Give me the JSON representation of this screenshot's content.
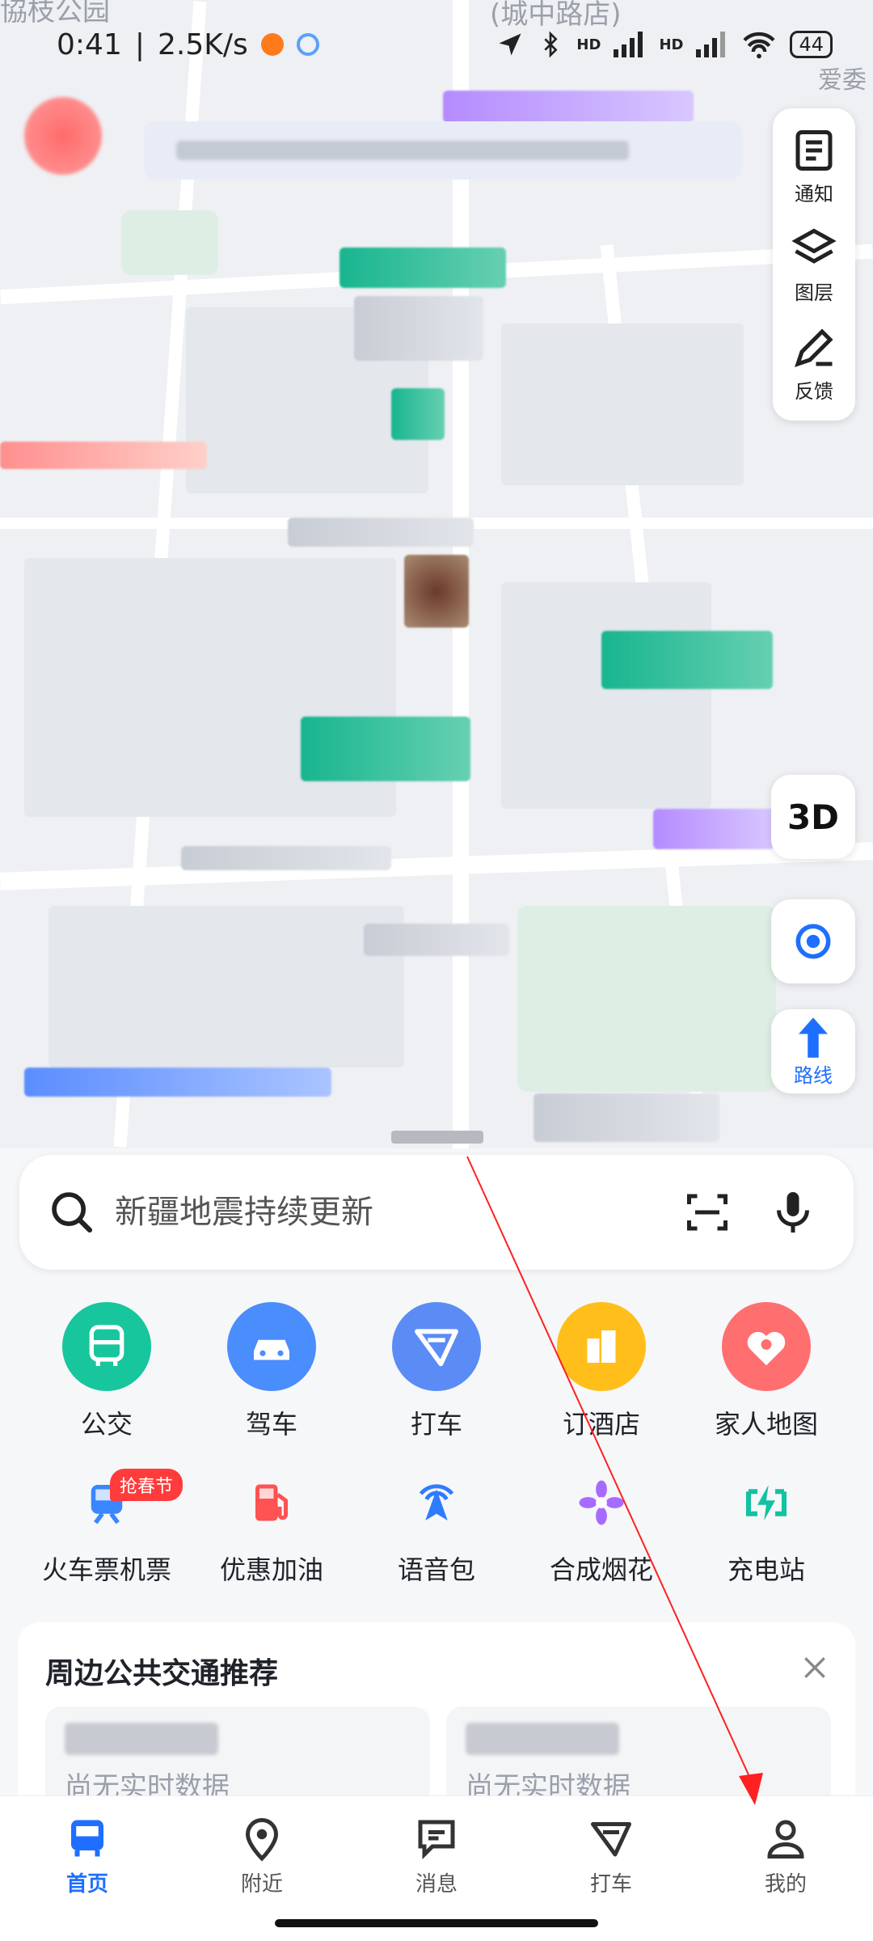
{
  "status_bar": {
    "time": "0:41",
    "speed": "2.5K/s",
    "network_1": "HD",
    "network_2": "HD",
    "battery": "44"
  },
  "map": {
    "labels": [
      "(城中路店)",
      "爱委"
    ]
  },
  "tools": [
    {
      "label": "通知",
      "icon": "notice-icon"
    },
    {
      "label": "图层",
      "icon": "layers-icon"
    },
    {
      "label": "反馈",
      "icon": "feedback-icon"
    }
  ],
  "map_buttons": {
    "three_d": "3D",
    "route": "路线"
  },
  "search": {
    "placeholder": "新疆地震持续更新"
  },
  "quick_actions": [
    {
      "label": "公交",
      "icon": "bus-icon",
      "color": "#17c69c"
    },
    {
      "label": "驾车",
      "icon": "car-icon",
      "color": "#4a8dfc"
    },
    {
      "label": "打车",
      "icon": "taxi-icon",
      "color": "#5b8cf6"
    },
    {
      "label": "订酒店",
      "icon": "hotel-icon",
      "color": "#ffbe1a"
    },
    {
      "label": "家人地图",
      "icon": "family-map-icon",
      "color": "#ff6f6f"
    }
  ],
  "services": [
    {
      "label": "火车票机票",
      "icon": "train-icon",
      "badge": "抢春节"
    },
    {
      "label": "优惠加油",
      "icon": "fuel-icon"
    },
    {
      "label": "语音包",
      "icon": "voice-pack-icon"
    },
    {
      "label": "合成烟花",
      "icon": "firework-icon"
    },
    {
      "label": "充电站",
      "icon": "charging-icon"
    }
  ],
  "transit_card": {
    "title": "周边公共交通推荐",
    "items": [
      {
        "status": "尚无实时数据"
      },
      {
        "status": "尚无实时数据"
      }
    ]
  },
  "nav": [
    {
      "label": "首页",
      "icon": "home-bus-icon",
      "active": true
    },
    {
      "label": "附近",
      "icon": "location-pin-icon"
    },
    {
      "label": "消息",
      "icon": "message-icon"
    },
    {
      "label": "打车",
      "icon": "taxi-nav-icon"
    },
    {
      "label": "我的",
      "icon": "profile-icon"
    }
  ],
  "colors": {
    "accent": "#1e6fff",
    "annotation": "#ff2020"
  }
}
